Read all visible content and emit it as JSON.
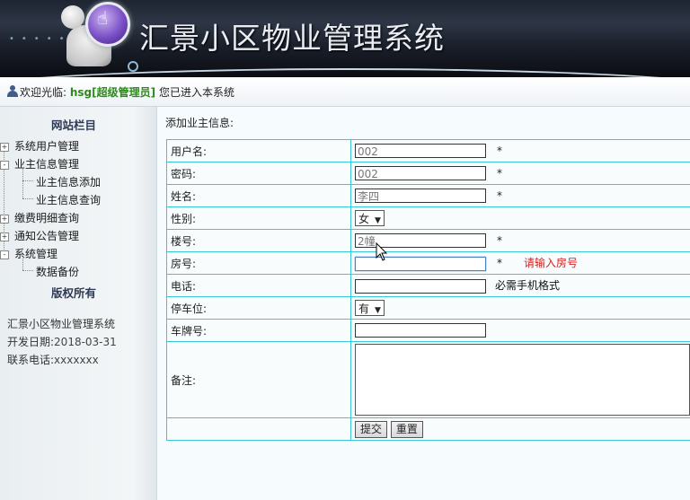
{
  "header": {
    "title": "汇景小区物业管理系统"
  },
  "welcome": {
    "prefix": "欢迎光临:",
    "username": "hsg[超级管理员]",
    "suffix": "您已进入本系统"
  },
  "sidebar": {
    "nav_title": "网站栏目",
    "items": [
      {
        "label": "系统用户管理",
        "toggle": "+"
      },
      {
        "label": "业主信息管理",
        "toggle": "-"
      },
      {
        "label": "业主信息添加"
      },
      {
        "label": "业主信息查询"
      },
      {
        "label": "缴费明细查询",
        "toggle": "+"
      },
      {
        "label": "通知公告管理",
        "toggle": "+"
      },
      {
        "label": "系统管理",
        "toggle": "-"
      },
      {
        "label": "数据备份"
      }
    ],
    "copyright_title": "版权所有",
    "info": {
      "system_name": "汇景小区物业管理系统",
      "dev_date_label": "开发日期:",
      "dev_date": "2018-03-31",
      "phone_label": "联系电话:",
      "phone": "xxxxxxx"
    }
  },
  "main": {
    "heading": "添加业主信息:",
    "form": {
      "username": {
        "label": "用户名:",
        "value": "002",
        "required": "*"
      },
      "password": {
        "label": "密码:",
        "value": "002",
        "required": "*"
      },
      "name": {
        "label": "姓名:",
        "value": "李四",
        "required": "*"
      },
      "gender": {
        "label": "性别:",
        "selected": "女"
      },
      "building": {
        "label": "楼号:",
        "value": "2幢",
        "required": "*"
      },
      "room": {
        "label": "房号:",
        "value": "",
        "required": "*",
        "error": "请输入房号"
      },
      "phone": {
        "label": "电话:",
        "value": "",
        "hint": "必需手机格式"
      },
      "parking": {
        "label": "停车位:",
        "selected": "有"
      },
      "plate": {
        "label": "车牌号:",
        "value": ""
      },
      "remark": {
        "label": "备注:",
        "value": ""
      },
      "submit_label": "提交",
      "reset_label": "重置"
    }
  },
  "colors": {
    "accent_green": "#2f8a1c",
    "error_red": "#d62020",
    "table_border": "#39c8d8"
  }
}
